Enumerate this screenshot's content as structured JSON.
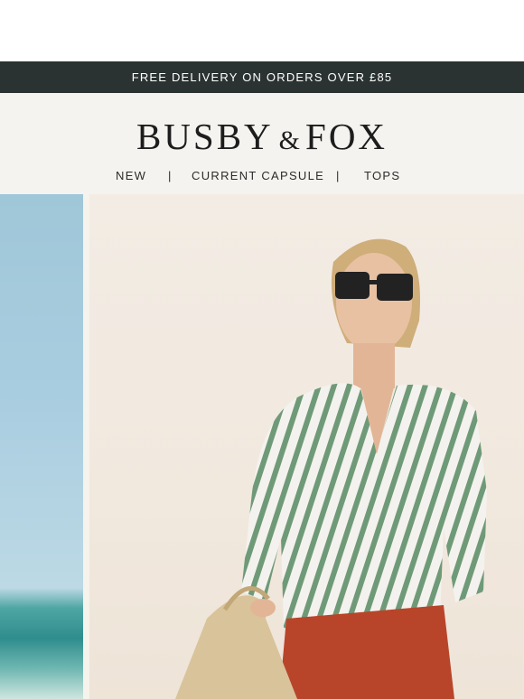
{
  "promo": {
    "text": "FREE DELIVERY ON ORDERS OVER £85"
  },
  "brand": {
    "part1": "BUSBY",
    "amp": "&",
    "part2": "FOX"
  },
  "nav": {
    "items": [
      "NEW",
      "CURRENT CAPSULE",
      "TOPS"
    ],
    "separator": "|"
  },
  "hero": {
    "left_image": "beach-sea-photo",
    "right_image": "model-striped-blouse-photo"
  },
  "colors": {
    "promo_bar": "#2b3332",
    "header_bg": "#f5f3ef",
    "stripe_green": "#6f9a78",
    "skirt_rust": "#b8452a"
  }
}
